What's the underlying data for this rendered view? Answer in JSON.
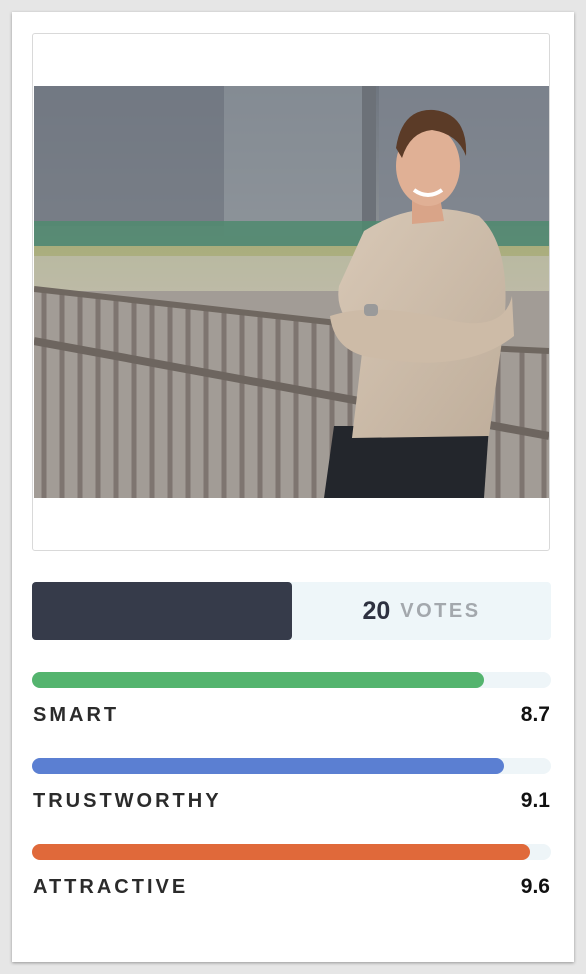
{
  "photo": {
    "icon": "portrait-photo",
    "subject": "smiling-man-leaning-on-railing"
  },
  "votes": {
    "count": "20",
    "label": "VOTES",
    "fill_fraction": 0.5
  },
  "metrics": [
    {
      "label": "SMART",
      "score": "8.7",
      "color": "#54b46e",
      "fill_fraction": 0.87
    },
    {
      "label": "TRUSTWORTHY",
      "score": "9.1",
      "color": "#5b7fd2",
      "fill_fraction": 0.91
    },
    {
      "label": "ATTRACTIVE",
      "score": "9.6",
      "color": "#e0693a",
      "fill_fraction": 0.96
    }
  ]
}
